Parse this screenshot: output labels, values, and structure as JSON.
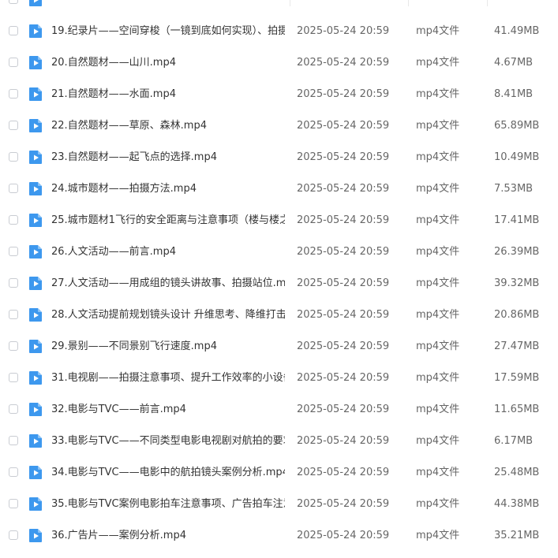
{
  "colors": {
    "icon_blue": "#3d98ee",
    "text_primary": "#333333",
    "text_secondary": "#666666"
  },
  "files": [
    {
      "name": "",
      "date": "",
      "type": "",
      "size": "",
      "icon": "video-file-icon"
    },
    {
      "name": "19.纪录片——空间穿梭（一镜到底如何实现）、拍摄…",
      "date": "2025-05-24 20:59",
      "type": "mp4文件",
      "size": "41.49MB",
      "icon": "video-file-icon"
    },
    {
      "name": "20.自然题材——山川.mp4",
      "date": "2025-05-24 20:59",
      "type": "mp4文件",
      "size": "4.67MB",
      "icon": "video-file-icon"
    },
    {
      "name": "21.自然题材——水面.mp4",
      "date": "2025-05-24 20:59",
      "type": "mp4文件",
      "size": "8.41MB",
      "icon": "video-file-icon"
    },
    {
      "name": "22.自然题材——草原、森林.mp4",
      "date": "2025-05-24 20:59",
      "type": "mp4文件",
      "size": "65.89MB",
      "icon": "video-file-icon"
    },
    {
      "name": "23.自然题材——起飞点的选择.mp4",
      "date": "2025-05-24 20:59",
      "type": "mp4文件",
      "size": "10.49MB",
      "icon": "video-file-icon"
    },
    {
      "name": "24.城市题材——拍摄方法.mp4",
      "date": "2025-05-24 20:59",
      "type": "mp4文件",
      "size": "7.53MB",
      "icon": "video-file-icon"
    },
    {
      "name": "25.城市题材1飞行的安全距离与注意事项（楼与楼之…",
      "date": "2025-05-24 20:59",
      "type": "mp4文件",
      "size": "17.41MB",
      "icon": "video-file-icon"
    },
    {
      "name": "26.人文活动——前言.mp4",
      "date": "2025-05-24 20:59",
      "type": "mp4文件",
      "size": "26.39MB",
      "icon": "video-file-icon"
    },
    {
      "name": "27.人文活动——用成组的镜头讲故事、拍摄站位.mp4",
      "date": "2025-05-24 20:59",
      "type": "mp4文件",
      "size": "39.32MB",
      "icon": "video-file-icon"
    },
    {
      "name": "28.人文活动提前规划镜头设计 升维思考、降维打击….",
      "date": "2025-05-24 20:59",
      "type": "mp4文件",
      "size": "20.86MB",
      "icon": "video-file-icon"
    },
    {
      "name": "29.景别——不同景别飞行速度.mp4",
      "date": "2025-05-24 20:59",
      "type": "mp4文件",
      "size": "27.47MB",
      "icon": "video-file-icon"
    },
    {
      "name": "31.电视剧——拍摄注意事项、提升工作效率的小设备…",
      "date": "2025-05-24 20:59",
      "type": "mp4文件",
      "size": "17.59MB",
      "icon": "video-file-icon"
    },
    {
      "name": "32.电影与TVC——前言.mp4",
      "date": "2025-05-24 20:59",
      "type": "mp4文件",
      "size": "11.65MB",
      "icon": "video-file-icon"
    },
    {
      "name": "33.电影与TVC——不同类型电影电视剧对航拍的要求…",
      "date": "2025-05-24 20:59",
      "type": "mp4文件",
      "size": "6.17MB",
      "icon": "video-file-icon"
    },
    {
      "name": "34.电影与TVC——电影中的航拍镜头案例分析.mp4",
      "date": "2025-05-24 20:59",
      "type": "mp4文件",
      "size": "25.48MB",
      "icon": "video-file-icon"
    },
    {
      "name": "35.电影与TVC案例电影拍车注意事项、广告拍车注意…",
      "date": "2025-05-24 20:59",
      "type": "mp4文件",
      "size": "44.38MB",
      "icon": "video-file-icon"
    },
    {
      "name": "36.广告片——案例分析.mp4",
      "date": "2025-05-24 20:59",
      "type": "mp4文件",
      "size": "35.21MB",
      "icon": "video-file-icon"
    }
  ]
}
